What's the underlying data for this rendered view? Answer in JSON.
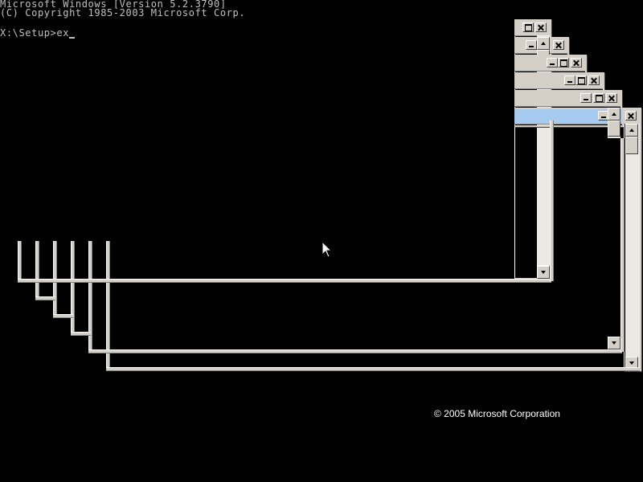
{
  "console": {
    "lines": [
      "Microsoft Windows [Version 5.2.3790]",
      "(C) Copyright 1985-2003 Microsoft Corp.",
      "",
      "X:\\Setup>ex"
    ]
  },
  "footer": {
    "copyright": "© 2005 Microsoft Corporation"
  },
  "colors": {
    "window_face": "#d4d0c8",
    "active_title": "#a6caf0",
    "console_text": "#c0c0c0",
    "background": "#000000"
  },
  "icons": [
    "minimize-icon",
    "maximize-icon",
    "close-icon",
    "scroll-up-icon",
    "scroll-down-icon",
    "mouse-pointer-icon"
  ]
}
